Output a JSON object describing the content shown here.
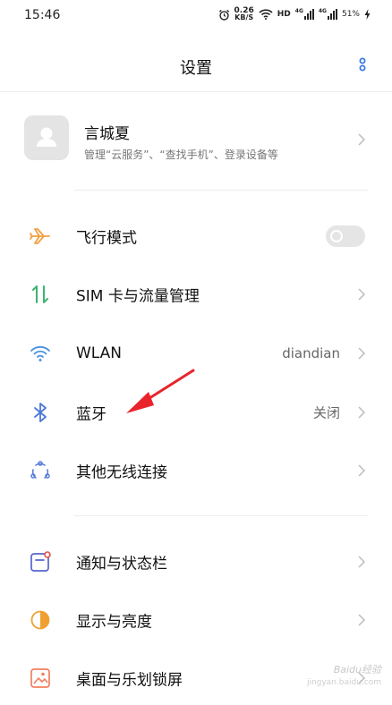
{
  "status": {
    "time": "15:46",
    "speed_value": "0.26",
    "speed_unit": "KB/S",
    "hd": "HD",
    "net1": "4G",
    "net2": "4G",
    "battery": "51%"
  },
  "header": {
    "title": "设置",
    "more_icon": "more-vertical-icon"
  },
  "account": {
    "name": "言城夏",
    "subtitle": "管理“云服务”、“查找手机”、登录设备等",
    "icon": "avatar-person-icon"
  },
  "rows": [
    {
      "label": "飞行模式",
      "icon": "airplane-icon",
      "control": "toggle",
      "toggle_on": false,
      "color": "#f0a040"
    },
    {
      "label": "SIM 卡与流量管理",
      "icon": "sim-data-icon",
      "control": "chevron",
      "color": "#3cb371"
    },
    {
      "label": "WLAN",
      "value": "diandian",
      "icon": "wifi-icon",
      "control": "chevron",
      "color": "#4a90e2"
    },
    {
      "label": "蓝牙",
      "value": "关闭",
      "icon": "bluetooth-icon",
      "control": "chevron",
      "color": "#4a78d8"
    },
    {
      "label": "其他无线连接",
      "icon": "wireless-connection-icon",
      "control": "chevron",
      "color": "#5b7fd8"
    },
    {
      "label": "通知与状态栏",
      "icon": "notification-icon",
      "control": "chevron",
      "color": "#5566cc"
    },
    {
      "label": "显示与亮度",
      "icon": "brightness-icon",
      "control": "chevron",
      "color": "#f0a030"
    },
    {
      "label": "桌面与乐划锁屏",
      "icon": "wallpaper-icon",
      "control": "chevron",
      "color": "#f08060"
    }
  ],
  "watermark": {
    "text": "Baidu经验",
    "sub": "jingyan.baidu.com"
  },
  "colors": {
    "annotation_arrow": "#e8242a",
    "divider": "#ececec"
  }
}
